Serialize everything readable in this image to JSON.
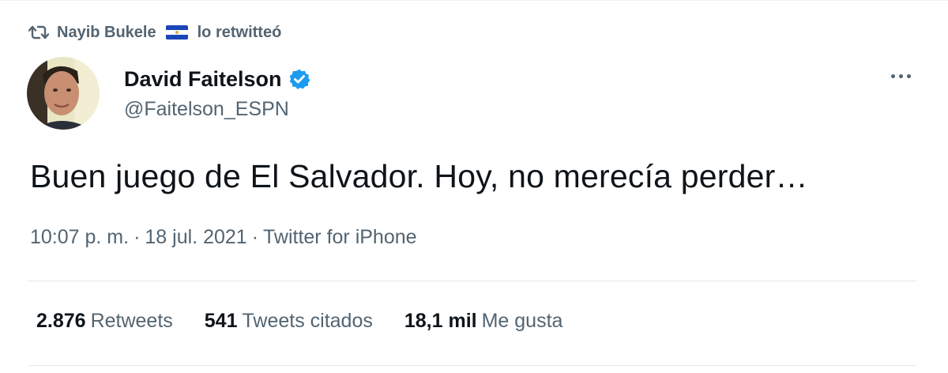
{
  "retweet_context": {
    "user": "Nayib Bukele",
    "suffix": "lo retwitteó",
    "retweet_icon": "retweet-icon",
    "flag_icon": "el-salvador-flag-icon"
  },
  "author": {
    "name": "David Faitelson",
    "handle": "@Faitelson_ESPN",
    "verified_icon": "verified-badge-icon",
    "verified_color": "#1d9bf0"
  },
  "menu": {
    "icon": "more-options-icon"
  },
  "tweet": {
    "text": "Buen juego de El Salvador. Hoy, no merecía perder…",
    "time": "10:07 p. m.",
    "separator": "·",
    "date": "18 jul. 2021",
    "source": "Twitter for iPhone"
  },
  "stats": {
    "retweets": {
      "count": "2.876",
      "label": "Retweets"
    },
    "quotes": {
      "count": "541",
      "label": "Tweets citados"
    },
    "likes": {
      "count": "18,1 mil",
      "label": "Me gusta"
    }
  },
  "colors": {
    "text_primary": "#0f1419",
    "text_secondary": "#536471",
    "divider": "#e4e8ea"
  }
}
